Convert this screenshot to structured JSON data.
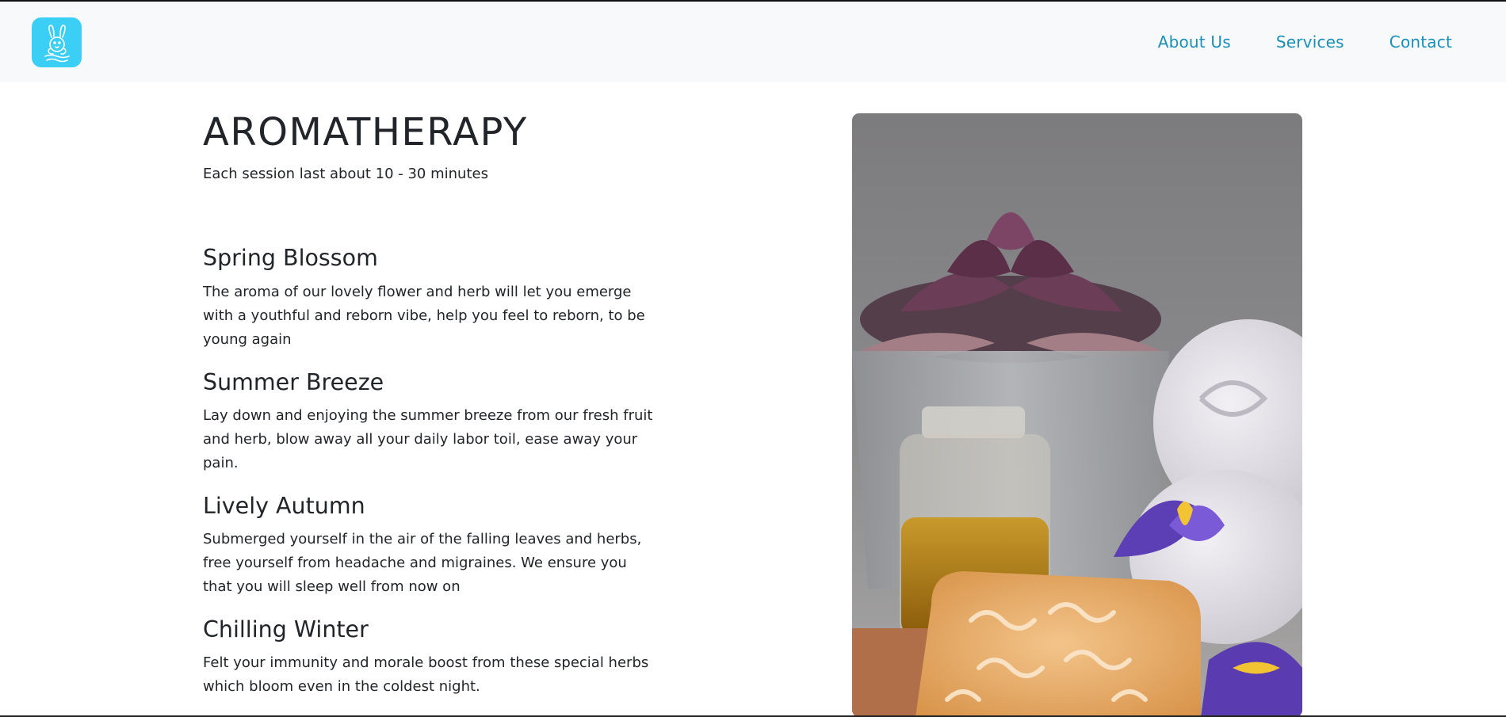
{
  "header": {
    "logo_icon": "bunny-spa-logo-icon",
    "logo_color": "#3ccff5",
    "nav": [
      {
        "label": "About Us"
      },
      {
        "label": "Services"
      },
      {
        "label": "Contact"
      }
    ],
    "nav_color": "#1a8fb8"
  },
  "main": {
    "title": "AROMATHERAPY",
    "subtitle": "Each session last about 10 - 30 minutes",
    "services": [
      {
        "name": "Spring Blossom",
        "description": "The aroma of our lovely flower and herb will let you emerge with a youthful and reborn vibe, help you feel to reborn, to be young again"
      },
      {
        "name": "Summer Breeze",
        "description": "Lay down and enjoying the summer breeze from our fresh fruit and herb, blow away all your daily labor toil, ease away your pain."
      },
      {
        "name": "Lively Autumn",
        "description": "Submerged yourself in the air of the falling leaves and herbs, free yourself from headache and migraines. We ensure you that you will sleep well from now on"
      },
      {
        "name": "Chilling Winter",
        "description": "Felt your immunity and morale boost from these special herbs which bloom even in the coldest night."
      }
    ],
    "photo_icon": "spa-products-photo"
  }
}
